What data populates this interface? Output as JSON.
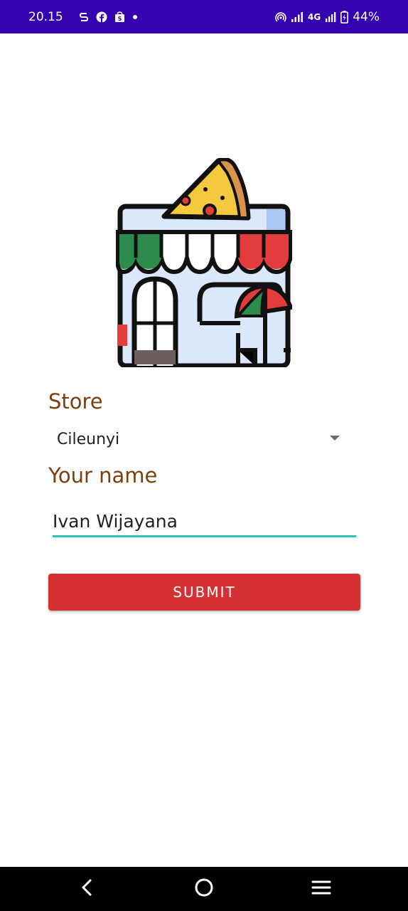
{
  "status_bar": {
    "time": "20.15",
    "network": "4G",
    "battery": "44%",
    "background_color": "#3500b0",
    "left_icons": [
      "s-badge-icon",
      "facebook-icon",
      "shopping-bag-icon",
      "dot-icon"
    ],
    "right_icons": [
      "hotspot-icon",
      "signal-icon",
      "signal-icon",
      "battery-charging-icon"
    ]
  },
  "logo": {
    "icon": "pizza-store-icon"
  },
  "form": {
    "store_label": "Store",
    "store_value": "Cileunyi",
    "name_label": "Your name",
    "name_value": "Ivan Wijayana",
    "submit_label": "SUBMIT"
  },
  "colors": {
    "label": "#7a3f12",
    "input_underline": "#2ec4b6",
    "button": "#d53032"
  },
  "nav_bar": {
    "icons": [
      "back-icon",
      "home-icon",
      "menu-icon"
    ]
  }
}
